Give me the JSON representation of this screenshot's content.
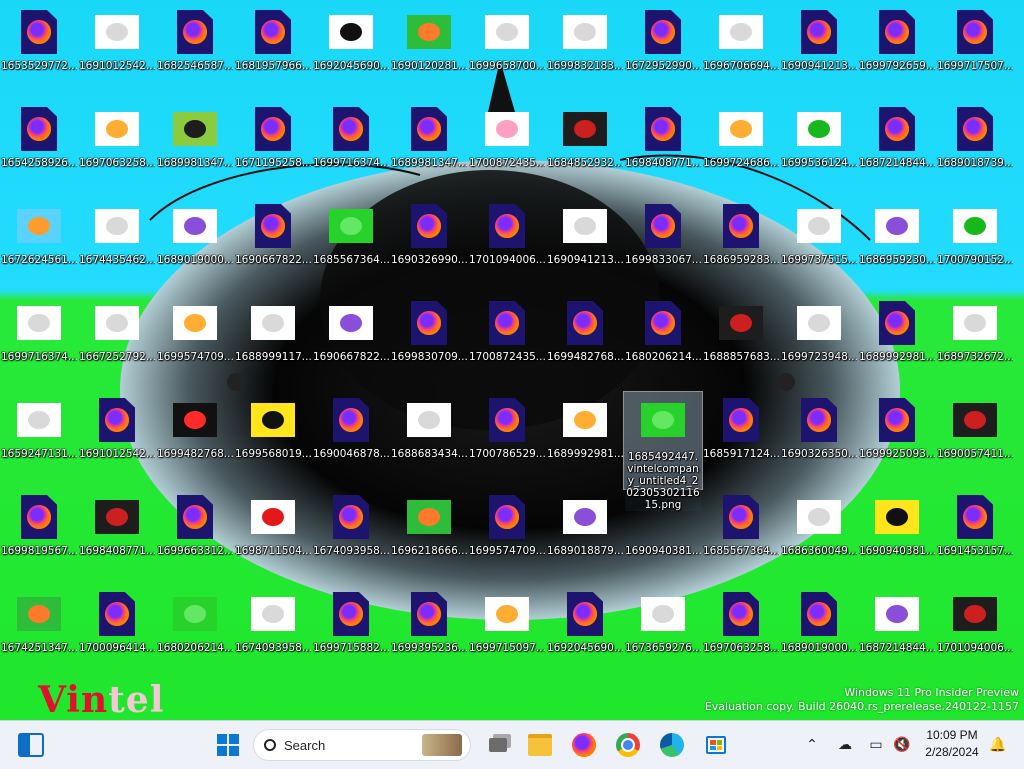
{
  "desktop": {
    "icons": [
      {
        "label": "1653529772...",
        "kind": "firefox"
      },
      {
        "label": "1691012542...",
        "kind": "image-white"
      },
      {
        "label": "1682546587...",
        "kind": "firefox"
      },
      {
        "label": "1681957966...",
        "kind": "firefox-framed"
      },
      {
        "label": "1692045690...",
        "kind": "image-face"
      },
      {
        "label": "1690120281...",
        "kind": "image-scene"
      },
      {
        "label": "1699658700...",
        "kind": "image-white"
      },
      {
        "label": "1699832183...",
        "kind": "image-white"
      },
      {
        "label": "1672952990...",
        "kind": "firefox"
      },
      {
        "label": "1696706694...",
        "kind": "image-white"
      },
      {
        "label": "1690941213...",
        "kind": "firefox"
      },
      {
        "label": "1699792659...",
        "kind": "firefox"
      },
      {
        "label": "1699717507...",
        "kind": "firefox"
      },
      {
        "label": "1654258926...",
        "kind": "firefox"
      },
      {
        "label": "1697063258...",
        "kind": "image-orange"
      },
      {
        "label": "1689981347...",
        "kind": "image-bee"
      },
      {
        "label": "1671195258...",
        "kind": "firefox"
      },
      {
        "label": "1699716374...",
        "kind": "firefox"
      },
      {
        "label": "1689981347...",
        "kind": "firefox"
      },
      {
        "label": "1700872435...",
        "kind": "image-pink"
      },
      {
        "label": "1684852932...",
        "kind": "image-dark"
      },
      {
        "label": "1698408771...",
        "kind": "firefox"
      },
      {
        "label": "1699724686...",
        "kind": "image-orange"
      },
      {
        "label": "1699536124...",
        "kind": "image-greendot"
      },
      {
        "label": "1687214844...",
        "kind": "firefox"
      },
      {
        "label": "1689018739...",
        "kind": "firefox"
      },
      {
        "label": "1672624561...",
        "kind": "image-snail"
      },
      {
        "label": "1674435462...",
        "kind": "image-white"
      },
      {
        "label": "1689019000...",
        "kind": "image-purple"
      },
      {
        "label": "1690667822...",
        "kind": "firefox"
      },
      {
        "label": "1685567364...",
        "kind": "image-green"
      },
      {
        "label": "1690326990...",
        "kind": "firefox-framed"
      },
      {
        "label": "1701094006...",
        "kind": "firefox-framed"
      },
      {
        "label": "1690941213...",
        "kind": "image-white"
      },
      {
        "label": "1699833067...",
        "kind": "firefox"
      },
      {
        "label": "1686959283...",
        "kind": "firefox"
      },
      {
        "label": "1699737515...",
        "kind": "image-white"
      },
      {
        "label": "1686959230...",
        "kind": "image-purple"
      },
      {
        "label": "1700790152...",
        "kind": "image-greendot"
      },
      {
        "label": "1699716374...",
        "kind": "image-white"
      },
      {
        "label": "1667252792...",
        "kind": "image-white"
      },
      {
        "label": "1699574709...",
        "kind": "image-orange"
      },
      {
        "label": "1688999117...",
        "kind": "image-white"
      },
      {
        "label": "1690667822...",
        "kind": "image-purple"
      },
      {
        "label": "1699830709...",
        "kind": "firefox"
      },
      {
        "label": "1700872435...",
        "kind": "firefox"
      },
      {
        "label": "1699482768...",
        "kind": "firefox"
      },
      {
        "label": "1680206214...",
        "kind": "firefox"
      },
      {
        "label": "1688857683...",
        "kind": "image-dark"
      },
      {
        "label": "1699723948...",
        "kind": "image-white"
      },
      {
        "label": "1689992981...",
        "kind": "firefox"
      },
      {
        "label": "1689732672...",
        "kind": "image-white"
      },
      {
        "label": "1659247131...",
        "kind": "image-white"
      },
      {
        "label": "1691012542...",
        "kind": "firefox"
      },
      {
        "label": "1699482768...",
        "kind": "image-dots"
      },
      {
        "label": "1699568019...",
        "kind": "image-yellow"
      },
      {
        "label": "1690046878...",
        "kind": "firefox"
      },
      {
        "label": "1688683434...",
        "kind": "image-white"
      },
      {
        "label": "1700786529...",
        "kind": "firefox"
      },
      {
        "label": "1689992981...",
        "kind": "image-orange"
      },
      {
        "label": "1685492447.vintelcompany_untitled4_20230530211615.png",
        "kind": "image-green",
        "selected": true
      },
      {
        "label": "1685917124...",
        "kind": "firefox"
      },
      {
        "label": "1690326350...",
        "kind": "firefox"
      },
      {
        "label": "1699925093...",
        "kind": "firefox"
      },
      {
        "label": "1690057411...",
        "kind": "image-dark"
      },
      {
        "label": "1699819567...",
        "kind": "firefox"
      },
      {
        "label": "1698408771...",
        "kind": "image-dark"
      },
      {
        "label": "1699663312...",
        "kind": "firefox"
      },
      {
        "label": "1698711504...",
        "kind": "image-red"
      },
      {
        "label": "1674093958...",
        "kind": "firefox"
      },
      {
        "label": "1696218666...",
        "kind": "image-scene"
      },
      {
        "label": "1699574709...",
        "kind": "firefox"
      },
      {
        "label": "1689018879...",
        "kind": "image-purple"
      },
      {
        "label": "1690940381...",
        "kind": "empty"
      },
      {
        "label": "1685567364...",
        "kind": "firefox"
      },
      {
        "label": "1686360049...",
        "kind": "image-white"
      },
      {
        "label": "1690940381...",
        "kind": "image-yellow"
      },
      {
        "label": "1691453157...",
        "kind": "firefox"
      },
      {
        "label": "1674251347...",
        "kind": "image-scene"
      },
      {
        "label": "1700096414...",
        "kind": "firefox"
      },
      {
        "label": "1680206214...",
        "kind": "image-green"
      },
      {
        "label": "1674093958...",
        "kind": "image-white"
      },
      {
        "label": "1699715882...",
        "kind": "firefox"
      },
      {
        "label": "1699395236...",
        "kind": "firefox"
      },
      {
        "label": "1699715097...",
        "kind": "image-orange"
      },
      {
        "label": "1692045690...",
        "kind": "firefox"
      },
      {
        "label": "1673659276...",
        "kind": "image-white"
      },
      {
        "label": "1697063258...",
        "kind": "firefox"
      },
      {
        "label": "1689019000...",
        "kind": "firefox"
      },
      {
        "label": "1687214844...",
        "kind": "image-purple"
      },
      {
        "label": "1701094006...",
        "kind": "image-dark"
      }
    ]
  },
  "watermark": {
    "line1": "Windows 11 Pro Insider Preview",
    "line2": "Evaluation copy. Build 26040.rs_prerelease.240122-1157"
  },
  "wallpaper": {
    "logo_text_1": "Vin",
    "logo_text_2": "tel"
  },
  "taskbar": {
    "search_placeholder": "Search",
    "time": "10:09 PM",
    "date": "2/28/2024",
    "icons": [
      "widgets-icon",
      "start-icon",
      "search-icon",
      "task-view-icon",
      "file-explorer-icon",
      "firefox-icon",
      "chrome-icon",
      "edge-icon",
      "store-icon",
      "tray-chevron-icon",
      "network-icon",
      "display-icon",
      "volume-muted-icon",
      "notifications-icon"
    ]
  },
  "colors": {
    "sky": "#23dcff",
    "grass": "#1fe72c",
    "taskbar": "#eef2f8"
  }
}
